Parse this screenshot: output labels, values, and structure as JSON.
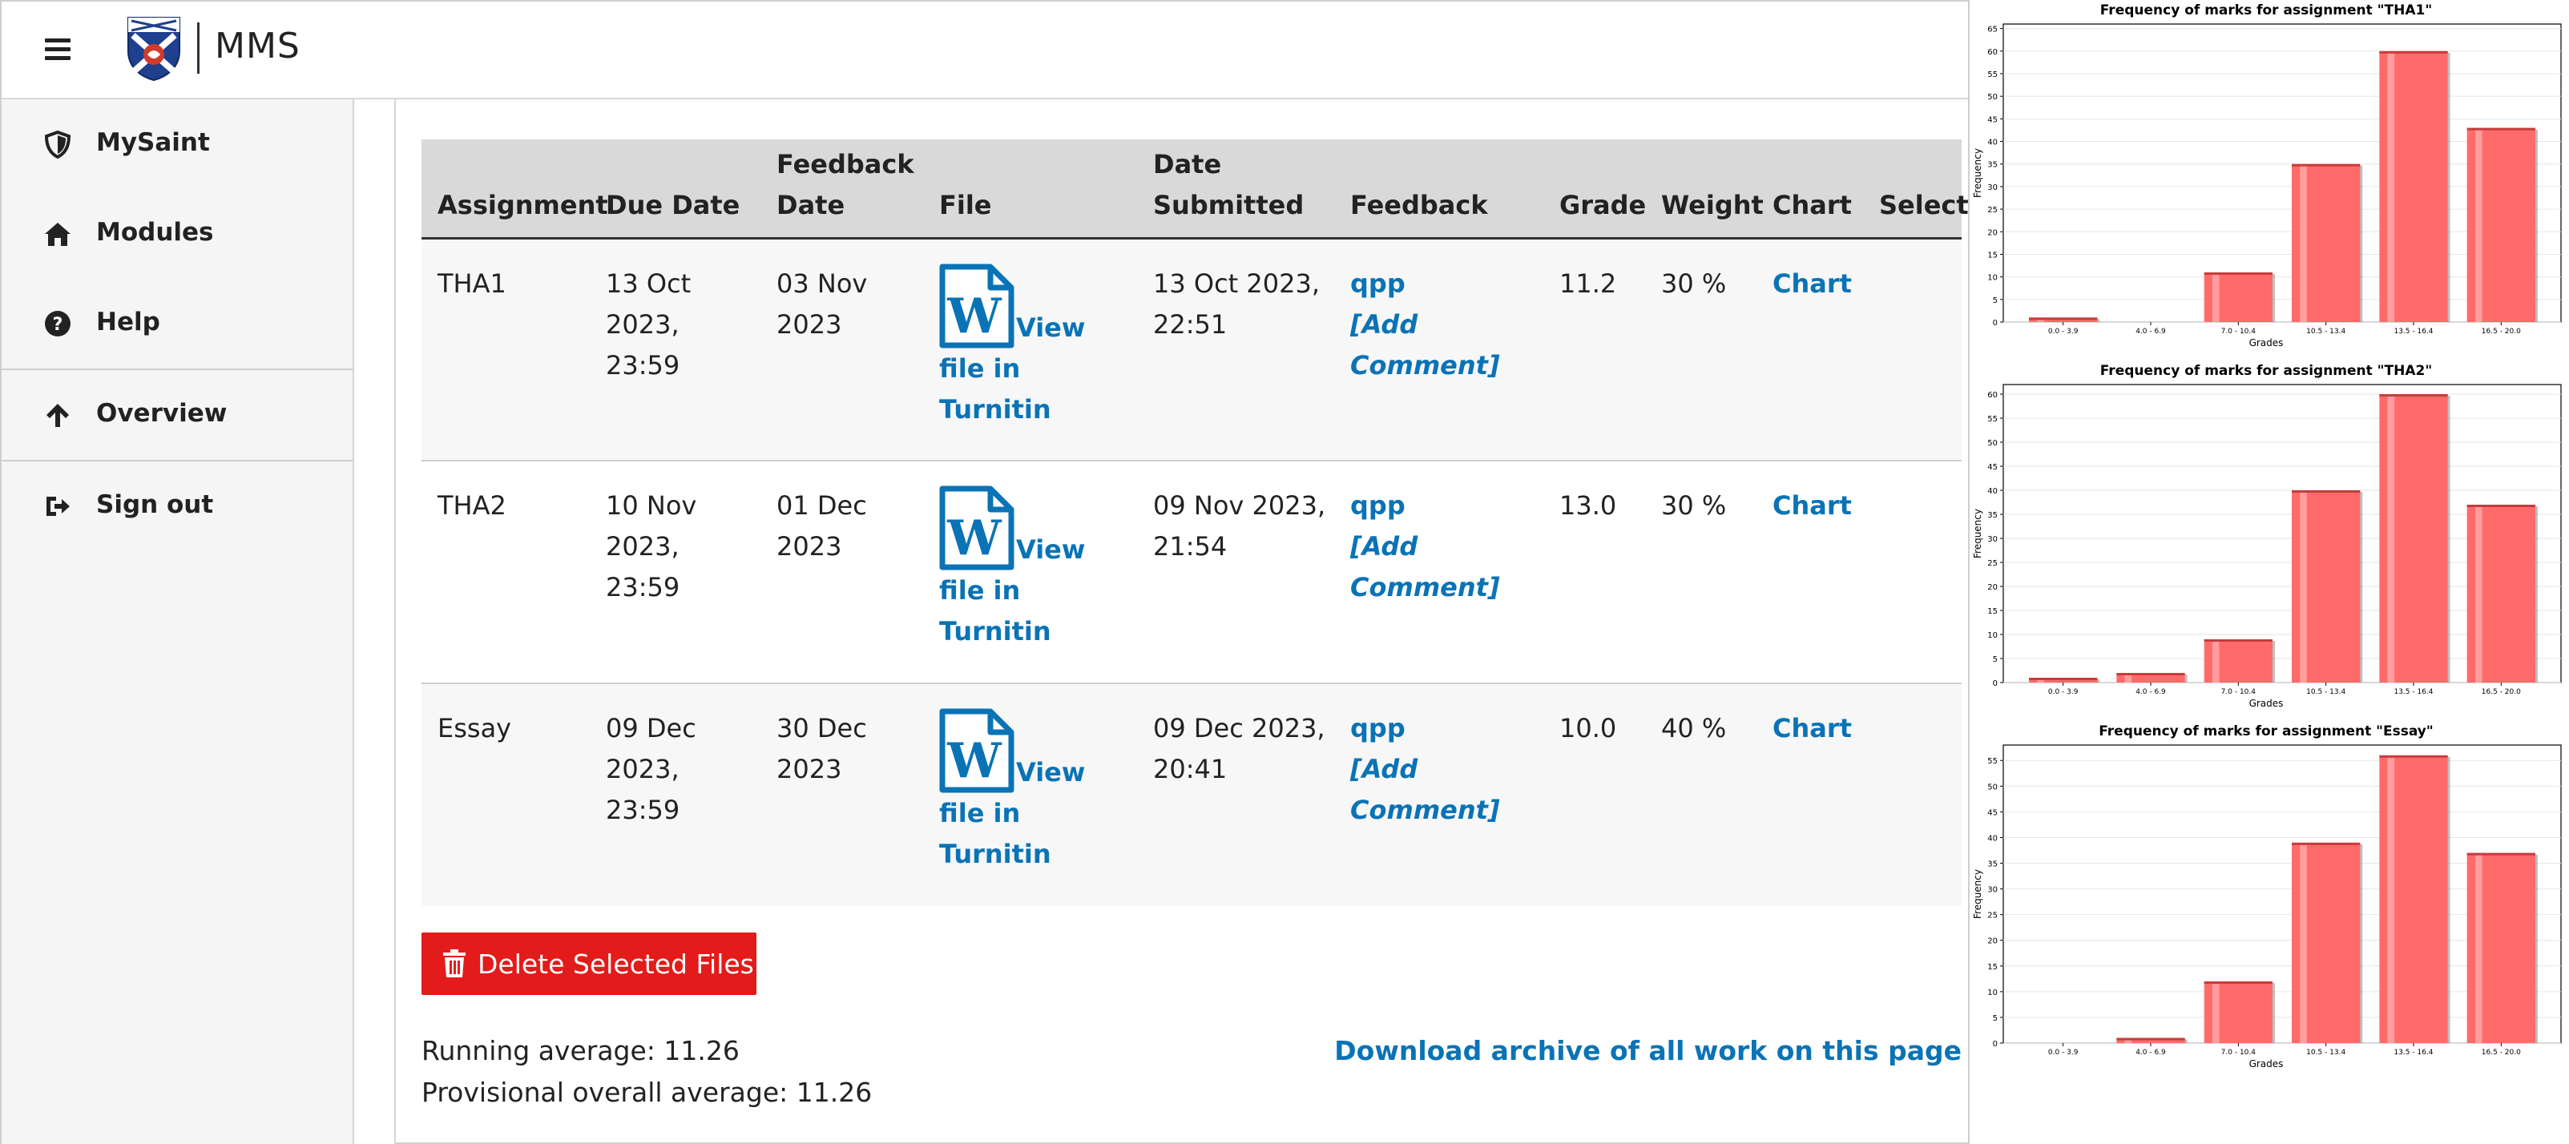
{
  "app": {
    "brand": "MMS"
  },
  "sidebar": {
    "items": [
      {
        "label": "MySaint",
        "icon": "shield-icon"
      },
      {
        "label": "Modules",
        "icon": "home-icon"
      },
      {
        "label": "Help",
        "icon": "question-circle-icon"
      },
      {
        "label": "Overview",
        "icon": "arrow-up-icon"
      },
      {
        "label": "Sign out",
        "icon": "sign-out-icon"
      }
    ]
  },
  "table": {
    "headers": {
      "assignment": "Assignment",
      "due": "Due Date",
      "feedback_date": "Feedback Date",
      "file": "File",
      "submitted": "Date Submitted",
      "feedback": "Feedback",
      "grade": "Grade",
      "weight": "Weight",
      "chart": "Chart",
      "select": "Select"
    },
    "rows": [
      {
        "assignment": "THA1",
        "due": "13 Oct 2023, 23:59",
        "feedback_date": "03 Nov 2023",
        "file_link": "View file in Turnitin",
        "submitted": "13 Oct 2023, 22:51",
        "feedback_marker": "qpp",
        "feedback_action": "[Add Comment]",
        "grade": "11.2",
        "weight": "30 %",
        "chart": "Chart"
      },
      {
        "assignment": "THA2",
        "due": "10 Nov 2023, 23:59",
        "feedback_date": "01 Dec 2023",
        "file_link": "View file in Turnitin",
        "submitted": "09 Nov 2023, 21:54",
        "feedback_marker": "qpp",
        "feedback_action": "[Add Comment]",
        "grade": "13.0",
        "weight": "30 %",
        "chart": "Chart"
      },
      {
        "assignment": "Essay",
        "due": "09 Dec 2023, 23:59",
        "feedback_date": "30 Dec 2023",
        "file_link": "View file in Turnitin",
        "submitted": "09 Dec 2023, 20:41",
        "feedback_marker": "qpp",
        "feedback_action": "[Add Comment]",
        "grade": "10.0",
        "weight": "40 %",
        "chart": "Chart"
      }
    ]
  },
  "actions": {
    "delete_label": "Delete Selected Files",
    "running_average": "Running average: 11.26",
    "provisional_average": "Provisional overall average: 11.26",
    "download_label": "Download archive of all work on this page"
  },
  "colors": {
    "link": "#0a73b6",
    "delete": "#e31b1b",
    "bar": "#ff6b6b"
  },
  "chart_data": [
    {
      "type": "bar",
      "title": "Frequency of marks for assignment \"THA1\"",
      "xlabel": "Grades",
      "ylabel": "Frequency",
      "categories": [
        "0.0 - 3.9",
        "4.0 - 6.9",
        "7.0 - 10.4",
        "10.5 - 13.4",
        "13.5 - 16.4",
        "16.5 - 20.0"
      ],
      "values": [
        1,
        0,
        11,
        35,
        60,
        43
      ],
      "ylim": [
        0,
        66
      ],
      "yticks": [
        0,
        5,
        10,
        15,
        20,
        25,
        30,
        35,
        40,
        45,
        50,
        55,
        60,
        65
      ],
      "grid": true
    },
    {
      "type": "bar",
      "title": "Frequency of marks for assignment \"THA2\"",
      "xlabel": "Grades",
      "ylabel": "Frequency",
      "categories": [
        "0.0 - 3.9",
        "4.0 - 6.9",
        "7.0 - 10.4",
        "10.5 - 13.4",
        "13.5 - 16.4",
        "16.5 - 20.0"
      ],
      "values": [
        1,
        2,
        9,
        40,
        60,
        37
      ],
      "ylim": [
        0,
        62
      ],
      "yticks": [
        0,
        5,
        10,
        15,
        20,
        25,
        30,
        35,
        40,
        45,
        50,
        55,
        60
      ],
      "grid": true
    },
    {
      "type": "bar",
      "title": "Frequency of marks for assignment \"Essay\"",
      "xlabel": "Grades",
      "ylabel": "Frequency",
      "categories": [
        "0.0 - 3.9",
        "4.0 - 6.9",
        "7.0 - 10.4",
        "10.5 - 13.4",
        "13.5 - 16.4",
        "16.5 - 20.0"
      ],
      "values": [
        0,
        1,
        12,
        39,
        56,
        37
      ],
      "ylim": [
        0,
        58
      ],
      "yticks": [
        0,
        5,
        10,
        15,
        20,
        25,
        30,
        35,
        40,
        45,
        50,
        55
      ],
      "grid": true
    }
  ]
}
